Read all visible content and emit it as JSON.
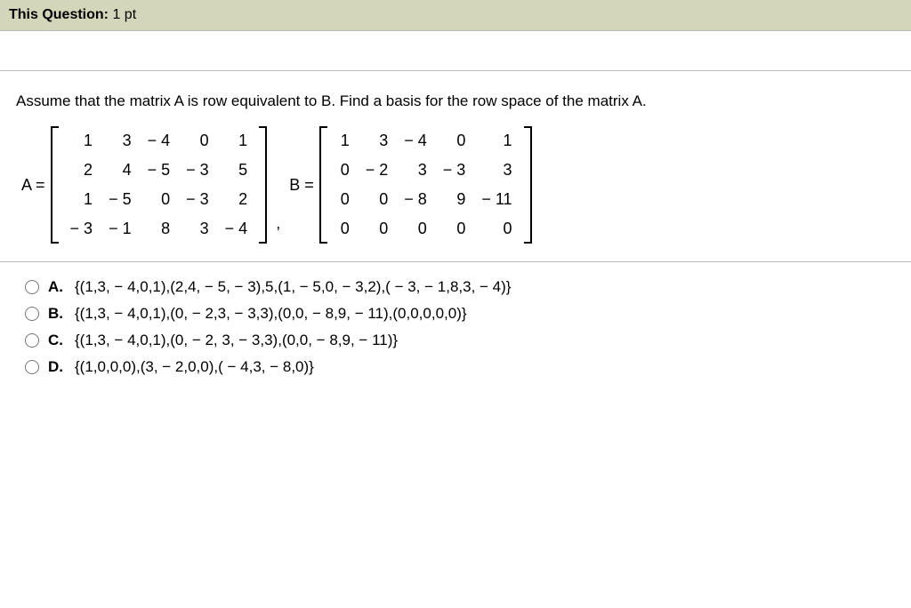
{
  "header": {
    "label": "This Question:",
    "points": " 1 pt"
  },
  "question": "Assume that the matrix A is row equivalent to B. Find a basis for the row space of the matrix A.",
  "matrixA": {
    "label": "A =",
    "rows": [
      [
        "1",
        "3",
        "− 4",
        "0",
        "1"
      ],
      [
        "2",
        "4",
        "− 5",
        "− 3",
        "5"
      ],
      [
        "1",
        "− 5",
        "0",
        "− 3",
        "2"
      ],
      [
        "− 3",
        "− 1",
        "8",
        "3",
        "− 4"
      ]
    ]
  },
  "separator_comma": ",",
  "matrixB": {
    "label": "B =",
    "rows": [
      [
        "1",
        "3",
        "− 4",
        "0",
        "1"
      ],
      [
        "0",
        "− 2",
        "3",
        "− 3",
        "3"
      ],
      [
        "0",
        "0",
        "− 8",
        "9",
        "− 11"
      ],
      [
        "0",
        "0",
        "0",
        "0",
        "0"
      ]
    ]
  },
  "choices": [
    {
      "letter": "A.",
      "text": "{(1,3, − 4,0,1),(2,4, − 5, − 3),5,(1, − 5,0, − 3,2),( − 3, − 1,8,3, − 4)}"
    },
    {
      "letter": "B.",
      "text": "{(1,3, − 4,0,1),(0, − 2,3, − 3,3),(0,0, − 8,9, − 11),(0,0,0,0,0)}"
    },
    {
      "letter": "C.",
      "text": "{(1,3, − 4,0,1),(0, − 2, 3, − 3,3),(0,0, − 8,9, − 11)}"
    },
    {
      "letter": "D.",
      "text": "{(1,0,0,0),(3, − 2,0,0),( − 4,3, − 8,0)}"
    }
  ]
}
